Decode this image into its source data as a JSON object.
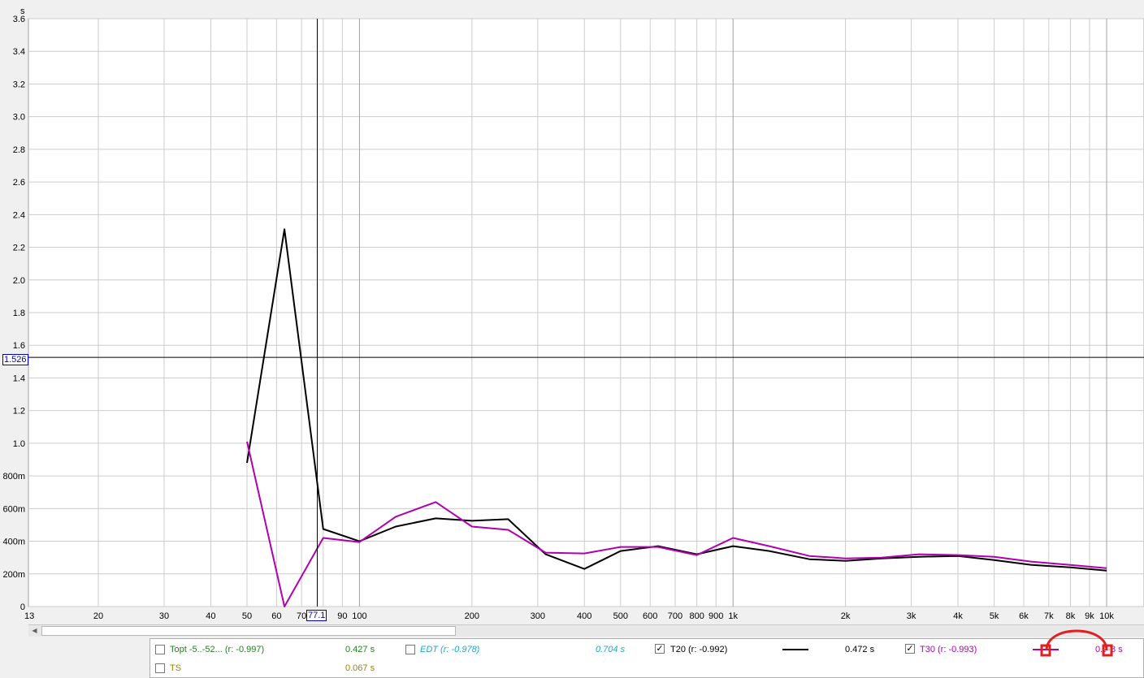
{
  "axis": {
    "y_unit": "s",
    "y_ticks": [
      "3.6",
      "3.4",
      "3.2",
      "3.0",
      "2.8",
      "2.6",
      "2.4",
      "2.2",
      "2.0",
      "1.8",
      "1.6",
      "1.4",
      "1.2",
      "1.0",
      "800m",
      "600m",
      "400m",
      "200m",
      "0"
    ],
    "x_ticks": [
      "13",
      "20",
      "30",
      "40",
      "50",
      "60",
      "70",
      "90",
      "100",
      "200",
      "300",
      "400",
      "500",
      "600",
      "700",
      "800",
      "900",
      "1k",
      "2k",
      "3k",
      "4k",
      "5k",
      "6k",
      "7k",
      "8k",
      "9k",
      "10k"
    ]
  },
  "cursor": {
    "x_label": "77.1",
    "y_label": "1.526",
    "x_value": 77.1,
    "y_value": 1.526
  },
  "chart_data": {
    "type": "line",
    "x_scale": "log",
    "xlim": [
      13,
      10000
    ],
    "ylim": [
      0,
      3.6
    ],
    "ylabel": "s",
    "grid": true,
    "series": [
      {
        "name": "T20",
        "color": "#000000",
        "x": [
          50,
          63,
          80,
          100,
          125,
          160,
          200,
          250,
          315,
          400,
          500,
          630,
          800,
          1000,
          1250,
          1600,
          2000,
          2500,
          3150,
          4000,
          5000,
          6300,
          8000,
          10000
        ],
        "values": [
          0.88,
          2.31,
          0.475,
          0.4,
          0.49,
          0.54,
          0.525,
          0.535,
          0.32,
          0.23,
          0.34,
          0.37,
          0.32,
          0.37,
          0.34,
          0.29,
          0.28,
          0.295,
          0.305,
          0.31,
          0.285,
          0.255,
          0.24,
          0.22
        ]
      },
      {
        "name": "T30",
        "color": "#b000b0",
        "x": [
          50,
          63,
          80,
          100,
          125,
          160,
          200,
          250,
          315,
          400,
          500,
          630,
          800,
          1000,
          1250,
          1600,
          2000,
          2500,
          3150,
          4000,
          5000,
          6300,
          8000,
          10000
        ],
        "values": [
          1.01,
          0.0,
          0.42,
          0.395,
          0.55,
          0.64,
          0.49,
          0.47,
          0.33,
          0.325,
          0.365,
          0.365,
          0.315,
          0.42,
          0.37,
          0.31,
          0.295,
          0.3,
          0.32,
          0.315,
          0.305,
          0.275,
          0.255,
          0.235
        ]
      }
    ]
  },
  "legend": {
    "topt": {
      "label": "Topt -5..-52... (r: -0.997)",
      "value": "0.427 s",
      "color": "#208020",
      "checked": false
    },
    "edt": {
      "label": "EDT (r: -0.978)",
      "value": "0.704 s",
      "color": "#20a8c8",
      "checked": false
    },
    "t20": {
      "label": "T20 (r: -0.992)",
      "value": "0.472 s",
      "color": "#000000",
      "checked": true
    },
    "t30": {
      "label": "T30 (r: -0.993)",
      "value": "0.?·8 s",
      "color": "#b000b0",
      "checked": true
    },
    "ts": {
      "label": "TS",
      "value": "0.067 s",
      "color": "#a08000",
      "checked": false
    }
  }
}
